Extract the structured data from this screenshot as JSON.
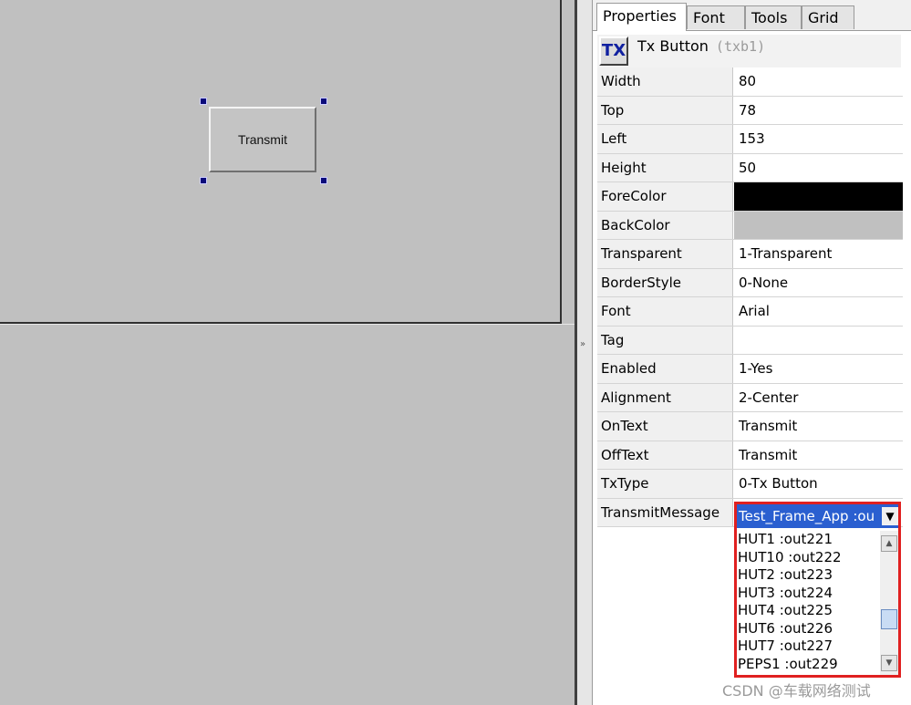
{
  "designer": {
    "button_label": "Transmit"
  },
  "tabs": [
    "Properties",
    "Font",
    "Tools",
    "Grid"
  ],
  "object": {
    "icon_label": "TX",
    "title": "Tx Button",
    "id": "(txb1)"
  },
  "properties": [
    {
      "key": "Width",
      "value": "80"
    },
    {
      "key": "Top",
      "value": "78"
    },
    {
      "key": "Left",
      "value": "153"
    },
    {
      "key": "Height",
      "value": "50"
    },
    {
      "key": "ForeColor",
      "value": "",
      "color": "#000000"
    },
    {
      "key": "BackColor",
      "value": "",
      "color": "#c0c0c0"
    },
    {
      "key": "Transparent",
      "value": "1-Transparent"
    },
    {
      "key": "BorderStyle",
      "value": "0-None"
    },
    {
      "key": "Font",
      "value": "Arial"
    },
    {
      "key": "Tag",
      "value": ""
    },
    {
      "key": "Enabled",
      "value": "1-Yes"
    },
    {
      "key": "Alignment",
      "value": "2-Center"
    },
    {
      "key": "OnText",
      "value": "Transmit"
    },
    {
      "key": "OffText",
      "value": "Transmit"
    },
    {
      "key": "TxType",
      "value": "0-Tx Button"
    },
    {
      "key": "TransmitMessage",
      "value": ""
    }
  ],
  "dropdown": {
    "selected": "Test_Frame_App :ou",
    "options": [
      "HUT1 :out221",
      "HUT10 :out222",
      "HUT2 :out223",
      "HUT3 :out224",
      "HUT4 :out225",
      "HUT6 :out226",
      "HUT7 :out227",
      "PEPS1 :out229"
    ],
    "highlight_color": "#2a5fd0",
    "border_color": "#e02020"
  },
  "watermark": "CSDN @车载网络测试"
}
